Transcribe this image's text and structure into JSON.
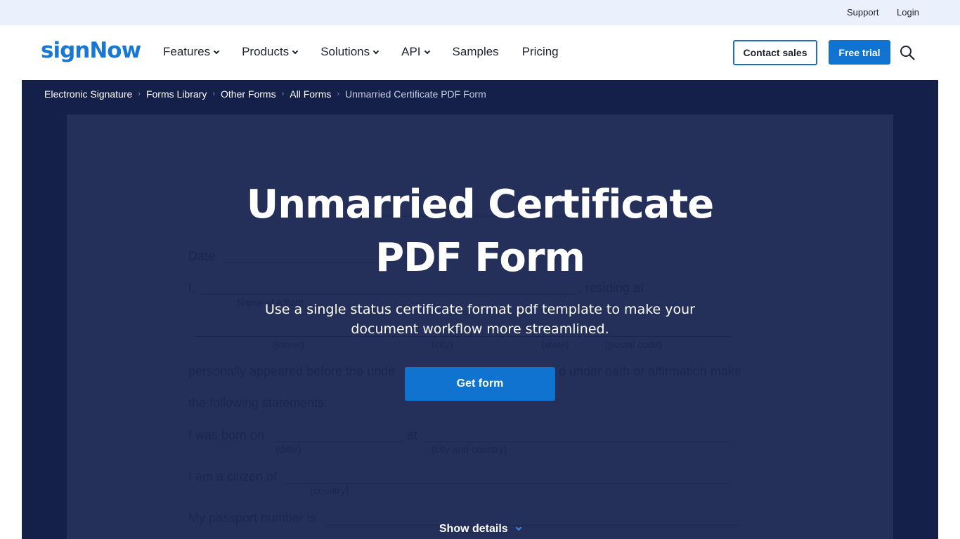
{
  "utility_bar": {
    "support": "Support",
    "login": "Login"
  },
  "header": {
    "logo": "signNow",
    "nav": [
      {
        "label": "Features",
        "has_dropdown": true
      },
      {
        "label": "Products",
        "has_dropdown": true
      },
      {
        "label": "Solutions",
        "has_dropdown": true
      },
      {
        "label": "API",
        "has_dropdown": true
      },
      {
        "label": "Samples",
        "has_dropdown": false
      },
      {
        "label": "Pricing",
        "has_dropdown": false
      }
    ],
    "contact_sales": "Contact sales",
    "free_trial": "Free trial",
    "search_icon": "search-icon"
  },
  "breadcrumb": [
    {
      "label": "Electronic Signature"
    },
    {
      "label": "Forms Library"
    },
    {
      "label": "Other Forms"
    },
    {
      "label": "All Forms"
    },
    {
      "label": "Unmarried Certificate PDF Form",
      "current": true
    }
  ],
  "hero": {
    "title_line1": "Unmarried Certificate",
    "title_line2": "PDF Form",
    "subtitle_line1": "Use a single status certificate format pdf template to make your",
    "subtitle_line2": "document workflow more streamlined.",
    "get_form": "Get form",
    "show_details": "Show details"
  },
  "document_preview": {
    "date_label": "Date",
    "i_label": "I,",
    "residing_at": ", residing at",
    "name_of_affiant": "Name of Affiant",
    "street": "(street)",
    "city": "(city)",
    "state": "(state)",
    "postal_code": "(postal code)",
    "line_personally_left": "personally appeared before the unde",
    "line_personally_right": "d under oath or affirmation make",
    "line_following": "the following statements:",
    "born_on": "I was born on",
    "at": "at",
    "date_hint": "(date)",
    "city_country_hint": "(city and country)",
    "citizen_of": "I am a citizen of",
    "country_hint": "(country)",
    "passport": "My passport number is"
  },
  "colors": {
    "brand_blue": "#0f73cf",
    "hero_bg": "#14204a",
    "doc_bg": "#243059",
    "utility_bg": "#eaf0fc"
  }
}
